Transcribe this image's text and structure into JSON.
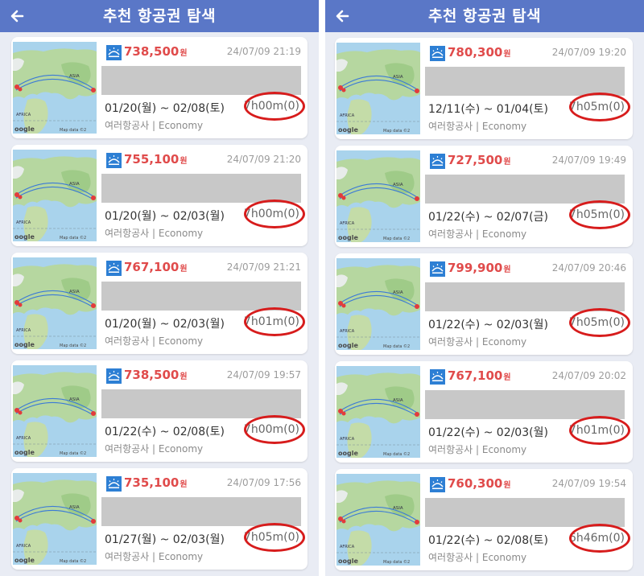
{
  "screen": {
    "title": "추천 항공권 탐색",
    "currency_unit": "원",
    "map_credit": "Map data ©2",
    "map_google": "oogle",
    "map_label_asia": "ASIA",
    "map_label_africa": "AFRICA"
  },
  "panels": [
    {
      "cards": [
        {
          "price": "738,500",
          "timestamp": "24/07/09 21:19",
          "dates": "01/20(월) ~ 02/08(토)",
          "duration": "7h00m(0)",
          "info": "여러항공사 | Economy"
        },
        {
          "price": "755,100",
          "timestamp": "24/07/09 21:20",
          "dates": "01/20(월) ~ 02/03(월)",
          "duration": "7h00m(0)",
          "info": "여러항공사 | Economy"
        },
        {
          "price": "767,100",
          "timestamp": "24/07/09 21:21",
          "dates": "01/20(월) ~ 02/03(월)",
          "duration": "7h01m(0)",
          "info": "여러항공사 | Economy"
        },
        {
          "price": "738,500",
          "timestamp": "24/07/09 19:57",
          "dates": "01/22(수) ~ 02/08(토)",
          "duration": "7h00m(0)",
          "info": "여러항공사 | Economy"
        },
        {
          "price": "735,100",
          "timestamp": "24/07/09 17:56",
          "dates": "01/27(월) ~ 02/03(월)",
          "duration": "7h05m(0)",
          "info": "여러항공사 | Economy"
        }
      ]
    },
    {
      "cards": [
        {
          "price": "780,300",
          "timestamp": "24/07/09 19:20",
          "dates": "12/11(수) ~ 01/04(토)",
          "duration": "7h05m(0)",
          "info": "여러항공사 | Economy"
        },
        {
          "price": "727,500",
          "timestamp": "24/07/09 19:49",
          "dates": "01/22(수) ~ 02/07(금)",
          "duration": "7h05m(0)",
          "info": "여러항공사 | Economy"
        },
        {
          "price": "799,900",
          "timestamp": "24/07/09 20:46",
          "dates": "01/22(수) ~ 02/03(월)",
          "duration": "7h05m(0)",
          "info": "여러항공사 | Economy"
        },
        {
          "price": "767,100",
          "timestamp": "24/07/09 20:02",
          "dates": "01/22(수) ~ 02/03(월)",
          "duration": "7h01m(0)",
          "info": "여러항공사 | Economy"
        },
        {
          "price": "760,300",
          "timestamp": "24/07/09 19:54",
          "dates": "01/22(수) ~ 02/08(토)",
          "duration": "6h46m(0)",
          "info": "여러항공사 | Economy"
        }
      ]
    }
  ],
  "icons": {
    "back": "arrow-left-icon",
    "airline": "airline-logo-icon",
    "map": "route-map"
  },
  "colors": {
    "appbar": "#5a77c7",
    "price": "#e04b4b",
    "highlight_circle": "#d71c1c",
    "redaction": "#c8c8c8",
    "background": "#e9ecf4"
  }
}
